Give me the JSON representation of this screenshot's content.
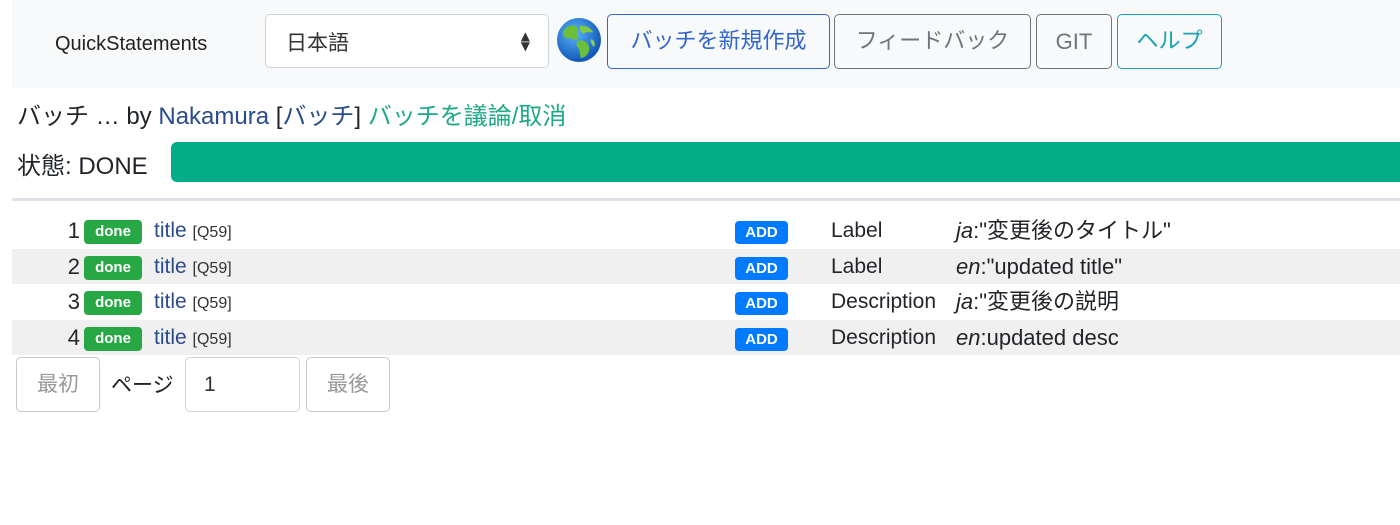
{
  "navbar": {
    "brand": "QuickStatements",
    "language_select": {
      "selected": "日本語"
    },
    "globe_icon": "globe-icon",
    "buttons": {
      "new_batch": "バッチを新規作成",
      "feedback": "フィードバック",
      "git": "GIT",
      "help": "ヘルプ"
    }
  },
  "batch": {
    "prefix": "バッチ … by ",
    "user": "Nakamura",
    "bracket_open": " [",
    "batch_link": "バッチ",
    "bracket_close": "] ",
    "discuss_link": "バッチを議論/取消"
  },
  "status": {
    "label": "状態: DONE",
    "progress": 1.0
  },
  "commands": [
    {
      "num": "1",
      "status": "done",
      "item_label": "title",
      "item_id": "[Q59]",
      "action": "ADD",
      "property": "Label",
      "lang": "ja",
      "value": ":\"変更後のタイトル\""
    },
    {
      "num": "2",
      "status": "done",
      "item_label": "title",
      "item_id": "[Q59]",
      "action": "ADD",
      "property": "Label",
      "lang": "en",
      "value": ":\"updated title\""
    },
    {
      "num": "3",
      "status": "done",
      "item_label": "title",
      "item_id": "[Q59]",
      "action": "ADD",
      "property": "Description",
      "lang": "ja",
      "value": ":\"変更後の説明"
    },
    {
      "num": "4",
      "status": "done",
      "item_label": "title",
      "item_id": "[Q59]",
      "action": "ADD",
      "property": "Description",
      "lang": "en",
      "value": ":updated desc"
    }
  ],
  "pager": {
    "first": "最初",
    "page_label": "ページ",
    "page_value": "1",
    "last": "最後"
  },
  "colors": {
    "progress": "#00ad86",
    "badge_done": "#28a745",
    "badge_add": "#007bff",
    "link_blue": "#2a4b8d",
    "link_teal": "#1ea888"
  }
}
